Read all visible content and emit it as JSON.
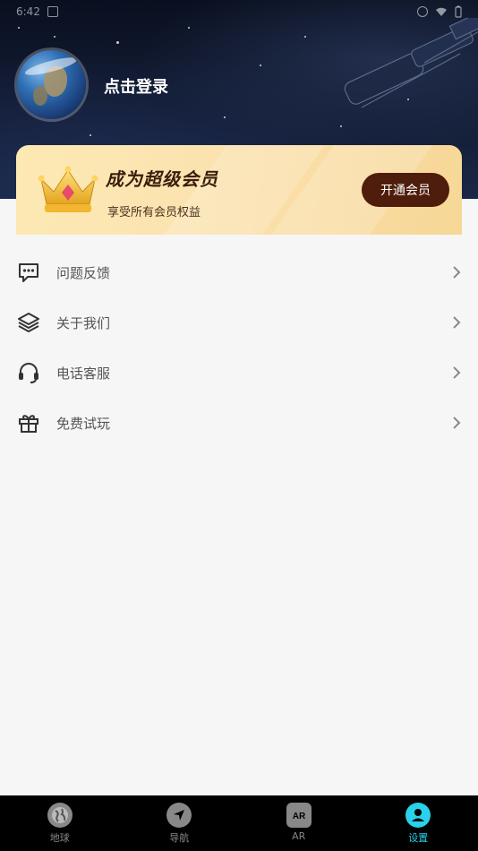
{
  "status_bar": {
    "time": "6:42"
  },
  "profile": {
    "login_text": "点击登录",
    "avatar_icon": "earth-avatar"
  },
  "vip": {
    "title": "成为超级会员",
    "subtitle": "享受所有会员权益",
    "button_label": "开通会员",
    "icon": "crown-icon"
  },
  "menu": {
    "items": [
      {
        "label": "问题反馈",
        "icon": "feedback-chat-icon"
      },
      {
        "label": "关于我们",
        "icon": "layers-icon"
      },
      {
        "label": "电话客服",
        "icon": "headset-icon"
      },
      {
        "label": "免费试玩",
        "icon": "gift-icon"
      }
    ]
  },
  "tabbar": {
    "tabs": [
      {
        "label": "地球",
        "icon": "globe-icon",
        "active": false
      },
      {
        "label": "导航",
        "icon": "navigation-icon",
        "active": false
      },
      {
        "label": "AR",
        "icon": "ar-icon",
        "active": false
      },
      {
        "label": "设置",
        "icon": "user-icon",
        "active": true
      }
    ]
  },
  "colors": {
    "accent": "#2ad1ea",
    "vip_button": "#4e1d0b",
    "vip_gradient_start": "#fde9b4",
    "vip_gradient_end": "#f6d796"
  }
}
